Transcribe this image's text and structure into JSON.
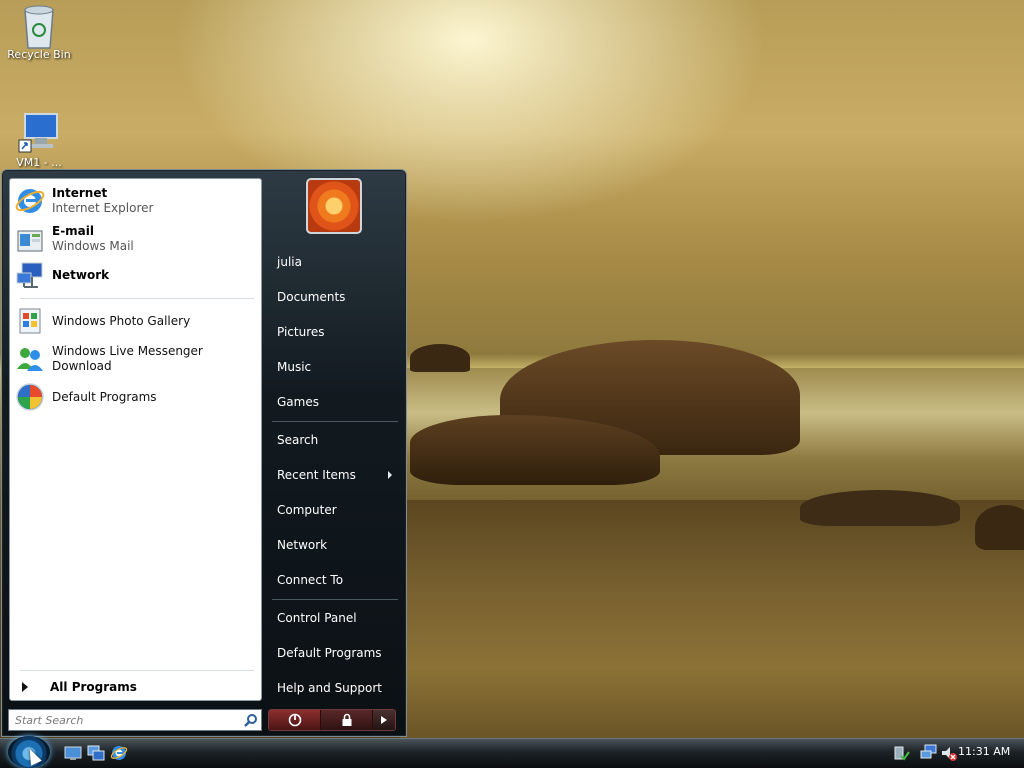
{
  "desktop": {
    "icons": [
      {
        "label": "Recycle Bin"
      },
      {
        "label": "VM1 - ..."
      }
    ]
  },
  "start_menu": {
    "pinned": [
      {
        "title": "Internet",
        "subtitle": "Internet Explorer",
        "icon": "internet-explorer-icon"
      },
      {
        "title": "E-mail",
        "subtitle": "Windows Mail",
        "icon": "windows-mail-icon"
      },
      {
        "title": "Network",
        "subtitle": "",
        "icon": "network-icon"
      }
    ],
    "recent": [
      {
        "label": "Windows Photo Gallery",
        "icon": "photo-gallery-icon"
      },
      {
        "label": "Windows Live Messenger Download",
        "icon": "messenger-icon"
      },
      {
        "label": "Default Programs",
        "icon": "default-programs-icon"
      }
    ],
    "all_programs_label": "All Programs",
    "search_placeholder": "Start Search",
    "right_items": [
      {
        "label": "julia"
      },
      {
        "label": "Documents"
      },
      {
        "label": "Pictures"
      },
      {
        "label": "Music"
      },
      {
        "label": "Games"
      },
      {
        "label": "Search"
      },
      {
        "label": "Recent Items",
        "has_submenu": true
      },
      {
        "label": "Computer"
      },
      {
        "label": "Network"
      },
      {
        "label": "Connect To"
      },
      {
        "label": "Control Panel"
      },
      {
        "label": "Default Programs"
      },
      {
        "label": "Help and Support"
      }
    ],
    "colors": {
      "power_button": "#8c2f2f",
      "menu_background": "#121a20"
    }
  },
  "taskbar": {
    "clock": "11:31 AM",
    "quick_launch": [
      "show-desktop-icon",
      "switch-windows-icon",
      "internet-explorer-icon"
    ],
    "tray": [
      "safely-remove-icon",
      "network-tray-icon",
      "volume-muted-icon"
    ]
  }
}
